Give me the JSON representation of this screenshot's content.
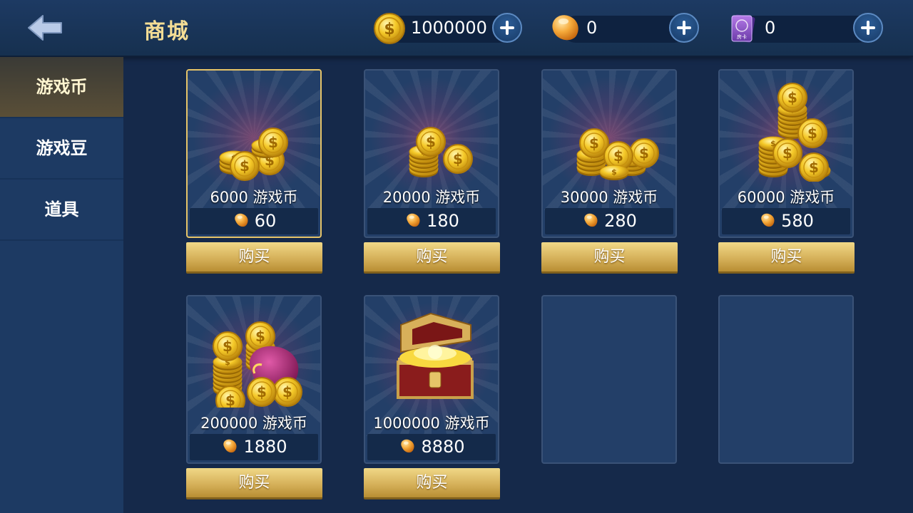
{
  "header": {
    "title": "商城",
    "coins": "1000000",
    "beans": "0",
    "room_cards": "0",
    "room_card_label": "房卡"
  },
  "sidebar": {
    "items": [
      {
        "label": "游戏币",
        "active": true
      },
      {
        "label": "游戏豆",
        "active": false
      },
      {
        "label": "道具",
        "active": false
      }
    ]
  },
  "products": [
    {
      "name": "6000 游戏币",
      "price": "60",
      "art": "coins-small-icon"
    },
    {
      "name": "20000 游戏币",
      "price": "180",
      "art": "coins-stack-icon"
    },
    {
      "name": "30000 游戏币",
      "price": "280",
      "art": "coins-pile-icon"
    },
    {
      "name": "60000 游戏币",
      "price": "580",
      "art": "coins-tower-icon"
    },
    {
      "name": "200000 游戏币",
      "price": "1880",
      "art": "coin-bag-icon"
    },
    {
      "name": "1000000 游戏币",
      "price": "8880",
      "art": "treasure-chest-icon"
    }
  ],
  "buy_label": "购买",
  "colors": {
    "accent_gold": "#e6c468",
    "title_gold": "#f4dd95",
    "panel_blue": "#233f68",
    "background": "#15294a"
  }
}
